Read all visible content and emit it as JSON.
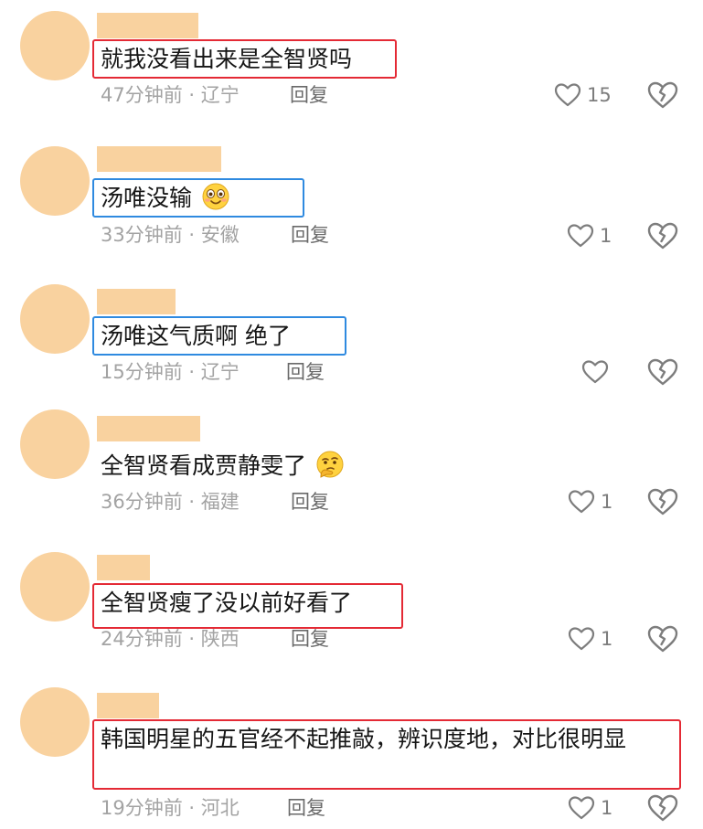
{
  "comments": [
    {
      "text": "就我没看出来是全智贤吗",
      "time": "47分钟前",
      "location": "辽宁",
      "reply": "回复",
      "likes": "15",
      "emoji": "",
      "highlight": "red"
    },
    {
      "text": "汤唯没输",
      "time": "33分钟前",
      "location": "安徽",
      "reply": "回复",
      "likes": "1",
      "emoji": "smiling-face-emoji",
      "highlight": "blue"
    },
    {
      "text": "汤唯这气质啊 绝了",
      "time": "15分钟前",
      "location": "辽宁",
      "reply": "回复",
      "likes": "",
      "emoji": "",
      "highlight": "blue"
    },
    {
      "text": "全智贤看成贾静雯了",
      "time": "36分钟前",
      "location": "福建",
      "reply": "回复",
      "likes": "1",
      "emoji": "thinking-face-emoji",
      "highlight": "none"
    },
    {
      "text": "全智贤瘦了没以前好看了",
      "time": "24分钟前",
      "location": "陕西",
      "reply": "回复",
      "likes": "1",
      "emoji": "",
      "highlight": "red"
    },
    {
      "text": "韩国明星的五官经不起推敲，辨识度地，对比很明显",
      "time": "19分钟前",
      "location": "河北",
      "reply": "回复",
      "likes": "1",
      "emoji": "",
      "highlight": "red"
    }
  ],
  "meta_separator": "·",
  "colors": {
    "avatar_placeholder": "#f9d29f",
    "highlight_red": "#e42a35",
    "highlight_blue": "#2f8ae0",
    "meta_text": "#a3a3a3"
  },
  "icons": {
    "like": "heart-outline-icon",
    "dislike": "broken-heart-icon"
  }
}
